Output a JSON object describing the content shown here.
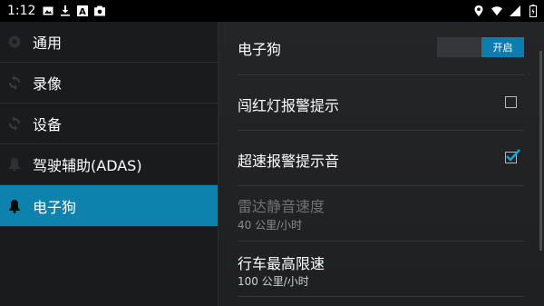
{
  "status_bar": {
    "time": "1:12",
    "left_icons": [
      "image-icon",
      "download-icon",
      "a-icon",
      "camera-icon"
    ],
    "right_icons": [
      "location-icon",
      "wifi-icon",
      "signal-icon",
      "battery-icon"
    ]
  },
  "sidebar": {
    "items": [
      {
        "label": "通用",
        "icon": "gear-icon",
        "active": false
      },
      {
        "label": "录像",
        "icon": "sync-icon",
        "active": false
      },
      {
        "label": "设备",
        "icon": "sync-icon",
        "active": false
      },
      {
        "label": "驾驶辅助(ADAS)",
        "icon": "bell-icon",
        "active": false
      },
      {
        "label": "电子狗",
        "icon": "bell-icon",
        "active": true
      }
    ]
  },
  "settings": {
    "edog": {
      "title": "电子狗",
      "toggle_label": "开启",
      "on": true
    },
    "red_light": {
      "title": "闯红灯报警提示",
      "checked": false
    },
    "overspeed_sound": {
      "title": "超速报警提示音",
      "checked": true
    },
    "radar_mute": {
      "title": "雷达静音速度",
      "value": "40 公里/小时",
      "enabled": false
    },
    "max_speed": {
      "title": "行车最高限速",
      "value": "100 公里/小时"
    }
  },
  "colors": {
    "accent": "#0d82ad",
    "background": "#1b1c1e"
  }
}
